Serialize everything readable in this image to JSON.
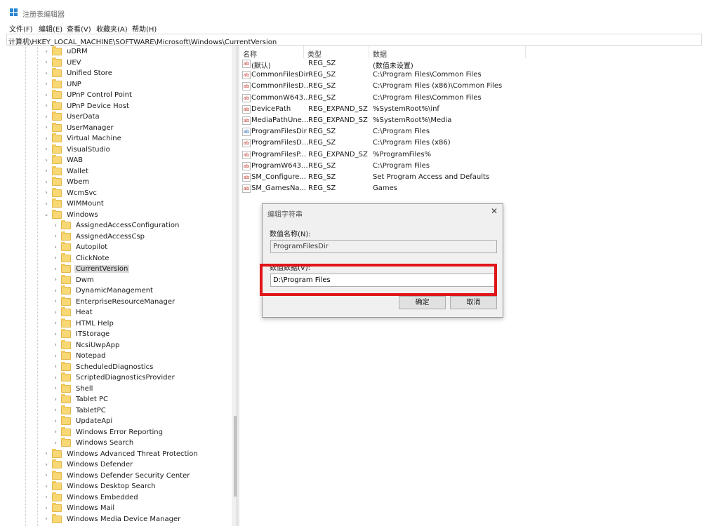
{
  "title": "注册表编辑器",
  "menu": [
    "文件(F)",
    "编辑(E)",
    "查看(V)",
    "收藏夹(A)",
    "帮助(H)"
  ],
  "address": "计算机\\HKEY_LOCAL_MACHINE\\SOFTWARE\\Microsoft\\Windows\\CurrentVersion",
  "tree": {
    "level1_top": [
      "uDRM",
      "UEV",
      "Unified Store",
      "UNP",
      "UPnP Control Point",
      "UPnP Device Host",
      "UserData",
      "UserManager",
      "Virtual Machine",
      "VisualStudio",
      "WAB",
      "Wallet",
      "Wbem",
      "WcmSvc",
      "WIMMount"
    ],
    "expanded": "Windows",
    "level2": [
      "AssignedAccessConfiguration",
      "AssignedAccessCsp",
      "Autopilot",
      "ClickNote",
      "CurrentVersion",
      "Dwm",
      "DynamicManagement",
      "EnterpriseResourceManager",
      "Heat",
      "HTML Help",
      "ITStorage",
      "NcsiUwpApp",
      "Notepad",
      "ScheduledDiagnostics",
      "ScriptedDiagnosticsProvider",
      "Shell",
      "Tablet PC",
      "TabletPC",
      "UpdateApi",
      "Windows Error Reporting",
      "Windows Search"
    ],
    "selected": "CurrentVersion",
    "level1_bottom": [
      "Windows Advanced Threat Protection",
      "Windows Defender",
      "Windows Defender Security Center",
      "Windows Desktop Search",
      "Windows Embedded",
      "Windows Mail",
      "Windows Media Device Manager"
    ]
  },
  "list": {
    "headers": [
      "名称",
      "类型",
      "数据"
    ],
    "rows": [
      {
        "icon": "string-value-icon",
        "name": "(默认)",
        "type": "REG_SZ",
        "data": "(数值未设置)"
      },
      {
        "icon": "string-value-icon",
        "name": "CommonFilesDir",
        "type": "REG_SZ",
        "data": "C:\\Program Files\\Common Files"
      },
      {
        "icon": "string-value-icon",
        "name": "CommonFilesD...",
        "type": "REG_SZ",
        "data": "C:\\Program Files (x86)\\Common Files"
      },
      {
        "icon": "string-value-icon",
        "name": "CommonW643...",
        "type": "REG_SZ",
        "data": "C:\\Program Files\\Common Files"
      },
      {
        "icon": "string-value-icon",
        "name": "DevicePath",
        "type": "REG_EXPAND_SZ",
        "data": "%SystemRoot%\\inf"
      },
      {
        "icon": "string-value-icon",
        "name": "MediaPathUne...",
        "type": "REG_EXPAND_SZ",
        "data": "%SystemRoot%\\Media"
      },
      {
        "icon": "binary-value-icon",
        "name": "ProgramFilesDir",
        "type": "REG_SZ",
        "data": "C:\\Program Files"
      },
      {
        "icon": "string-value-icon",
        "name": "ProgramFilesD...",
        "type": "REG_SZ",
        "data": "C:\\Program Files (x86)"
      },
      {
        "icon": "string-value-icon",
        "name": "ProgramFilesP...",
        "type": "REG_EXPAND_SZ",
        "data": "%ProgramFiles%"
      },
      {
        "icon": "string-value-icon",
        "name": "ProgramW643...",
        "type": "REG_SZ",
        "data": "C:\\Program Files"
      },
      {
        "icon": "string-value-icon",
        "name": "SM_Configure...",
        "type": "REG_SZ",
        "data": "Set Program Access and Defaults"
      },
      {
        "icon": "string-value-icon",
        "name": "SM_GamesNa...",
        "type": "REG_SZ",
        "data": "Games"
      }
    ]
  },
  "dialog": {
    "title": "编辑字符串",
    "name_label": "数值名称(N):",
    "name_value": "ProgramFilesDir",
    "data_label": "数值数据(V):",
    "data_value": "D:\\Program Files",
    "ok": "确定",
    "cancel": "取消"
  },
  "colors": {
    "highlight": "#e0151a",
    "folder": "#f8d775"
  }
}
